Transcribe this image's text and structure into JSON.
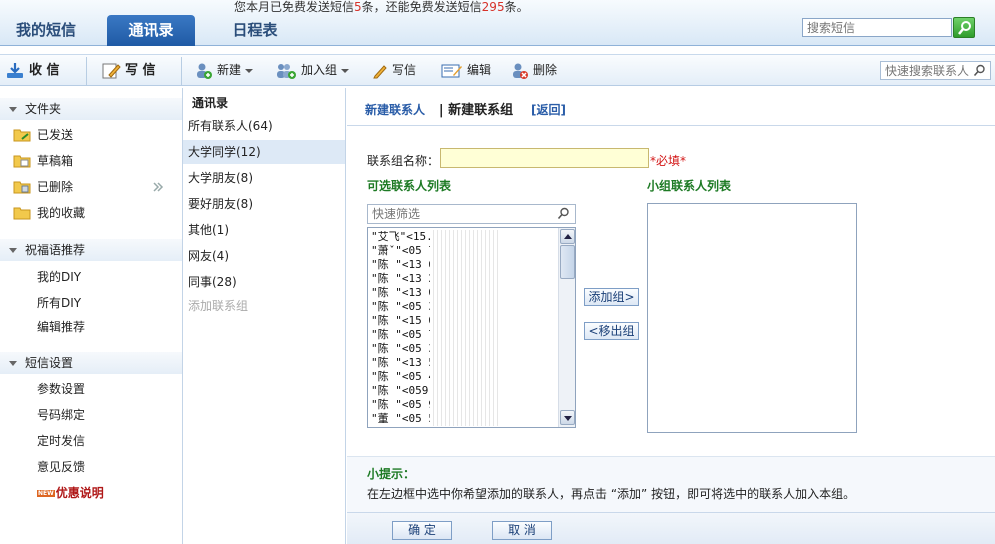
{
  "notice": {
    "prefix": "您本月已免费发送短信",
    "sent": "5",
    "middle": "条，还能免费发送短信",
    "remaining": "295",
    "suffix": "条。"
  },
  "main_tabs": [
    "我的短信",
    "通讯录",
    "日程表"
  ],
  "search": {
    "placeholder": "搜索短信"
  },
  "toolbar": {
    "inbox": "收 信",
    "compose": "写 信",
    "new": "新建",
    "add_to_group": "加入组",
    "write": "写信",
    "edit": "编辑",
    "delete": "删除",
    "quick_search_placeholder": "快速搜索联系人"
  },
  "sidebar": {
    "folders_title": "文件夹",
    "folders": [
      "已发送",
      "草稿箱",
      "已删除",
      "我的收藏"
    ],
    "blessing_title": "祝福语推荐",
    "blessing": [
      "我的DIY",
      "所有DIY",
      "编辑推荐"
    ],
    "settings_title": "短信设置",
    "settings": [
      "参数设置",
      "号码绑定",
      "定时发信",
      "意见反馈"
    ],
    "promo_badge": "NEW",
    "promo": "优惠说明"
  },
  "groups": {
    "title": "通讯录",
    "items": [
      "所有联系人(64)",
      "大学同学(12)",
      "大学朋友(8)",
      "要好朋友(8)",
      "其他(1)",
      "网友(4)",
      "同事(28)"
    ],
    "add": "添加联系组"
  },
  "content": {
    "crumb_new_contact": "新建联系人",
    "crumb_new_group": "新建联系组",
    "crumb_back": "[返回]",
    "name_label": "联系组名称：",
    "name_value": "",
    "required": "*必填*",
    "available_title": "可选联系人列表",
    "group_title": "小组联系人列表",
    "filter_placeholder": "快速筛选",
    "contacts": [
      "\"艾飞\"<15.  .   .83>",
      "\"萧ˇ\"<05      70>",
      "\"陈   \"<13       60>",
      "\"陈  \"<13       27>",
      "\"陈  \"<13       04>",
      "\"陈  \"<05       33>",
      "\"陈   \"<15       04>",
      "\"陈  \"<05       75>",
      "\"陈  \"<05       35>",
      "\"陈  \"<13       56>",
      "\"陈  \"<05       47>",
      "\"陈  \"<059      01>",
      "\"陈  \"<05       9>",
      "\"董  \"<05       56>"
    ],
    "add_button": "添加组>",
    "remove_button": "<移出组",
    "tips_title": "小提示：",
    "tips_text": "在左边框中选中你希望添加的联系人，再点击 “添加” 按钮，即可将选中的联系人加入本组。",
    "ok": "确 定",
    "cancel": "取 消"
  }
}
